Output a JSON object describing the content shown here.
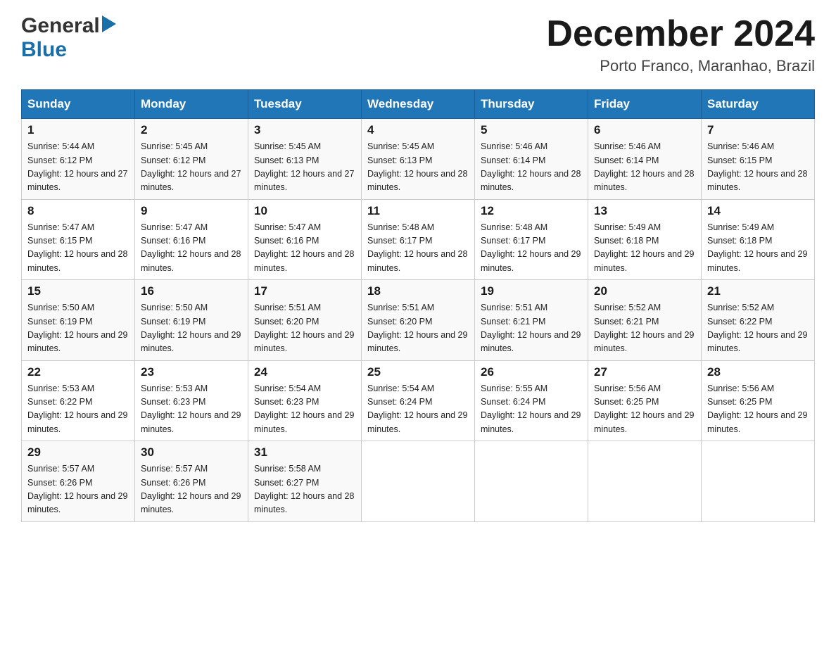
{
  "header": {
    "logo": {
      "general": "General",
      "blue": "Blue",
      "arrow_color": "#1a6fa8"
    },
    "title": "December 2024",
    "location": "Porto Franco, Maranhao, Brazil"
  },
  "calendar": {
    "days_of_week": [
      "Sunday",
      "Monday",
      "Tuesday",
      "Wednesday",
      "Thursday",
      "Friday",
      "Saturday"
    ],
    "weeks": [
      [
        {
          "day": "1",
          "sunrise": "Sunrise: 5:44 AM",
          "sunset": "Sunset: 6:12 PM",
          "daylight": "Daylight: 12 hours and 27 minutes."
        },
        {
          "day": "2",
          "sunrise": "Sunrise: 5:45 AM",
          "sunset": "Sunset: 6:12 PM",
          "daylight": "Daylight: 12 hours and 27 minutes."
        },
        {
          "day": "3",
          "sunrise": "Sunrise: 5:45 AM",
          "sunset": "Sunset: 6:13 PM",
          "daylight": "Daylight: 12 hours and 27 minutes."
        },
        {
          "day": "4",
          "sunrise": "Sunrise: 5:45 AM",
          "sunset": "Sunset: 6:13 PM",
          "daylight": "Daylight: 12 hours and 28 minutes."
        },
        {
          "day": "5",
          "sunrise": "Sunrise: 5:46 AM",
          "sunset": "Sunset: 6:14 PM",
          "daylight": "Daylight: 12 hours and 28 minutes."
        },
        {
          "day": "6",
          "sunrise": "Sunrise: 5:46 AM",
          "sunset": "Sunset: 6:14 PM",
          "daylight": "Daylight: 12 hours and 28 minutes."
        },
        {
          "day": "7",
          "sunrise": "Sunrise: 5:46 AM",
          "sunset": "Sunset: 6:15 PM",
          "daylight": "Daylight: 12 hours and 28 minutes."
        }
      ],
      [
        {
          "day": "8",
          "sunrise": "Sunrise: 5:47 AM",
          "sunset": "Sunset: 6:15 PM",
          "daylight": "Daylight: 12 hours and 28 minutes."
        },
        {
          "day": "9",
          "sunrise": "Sunrise: 5:47 AM",
          "sunset": "Sunset: 6:16 PM",
          "daylight": "Daylight: 12 hours and 28 minutes."
        },
        {
          "day": "10",
          "sunrise": "Sunrise: 5:47 AM",
          "sunset": "Sunset: 6:16 PM",
          "daylight": "Daylight: 12 hours and 28 minutes."
        },
        {
          "day": "11",
          "sunrise": "Sunrise: 5:48 AM",
          "sunset": "Sunset: 6:17 PM",
          "daylight": "Daylight: 12 hours and 28 minutes."
        },
        {
          "day": "12",
          "sunrise": "Sunrise: 5:48 AM",
          "sunset": "Sunset: 6:17 PM",
          "daylight": "Daylight: 12 hours and 29 minutes."
        },
        {
          "day": "13",
          "sunrise": "Sunrise: 5:49 AM",
          "sunset": "Sunset: 6:18 PM",
          "daylight": "Daylight: 12 hours and 29 minutes."
        },
        {
          "day": "14",
          "sunrise": "Sunrise: 5:49 AM",
          "sunset": "Sunset: 6:18 PM",
          "daylight": "Daylight: 12 hours and 29 minutes."
        }
      ],
      [
        {
          "day": "15",
          "sunrise": "Sunrise: 5:50 AM",
          "sunset": "Sunset: 6:19 PM",
          "daylight": "Daylight: 12 hours and 29 minutes."
        },
        {
          "day": "16",
          "sunrise": "Sunrise: 5:50 AM",
          "sunset": "Sunset: 6:19 PM",
          "daylight": "Daylight: 12 hours and 29 minutes."
        },
        {
          "day": "17",
          "sunrise": "Sunrise: 5:51 AM",
          "sunset": "Sunset: 6:20 PM",
          "daylight": "Daylight: 12 hours and 29 minutes."
        },
        {
          "day": "18",
          "sunrise": "Sunrise: 5:51 AM",
          "sunset": "Sunset: 6:20 PM",
          "daylight": "Daylight: 12 hours and 29 minutes."
        },
        {
          "day": "19",
          "sunrise": "Sunrise: 5:51 AM",
          "sunset": "Sunset: 6:21 PM",
          "daylight": "Daylight: 12 hours and 29 minutes."
        },
        {
          "day": "20",
          "sunrise": "Sunrise: 5:52 AM",
          "sunset": "Sunset: 6:21 PM",
          "daylight": "Daylight: 12 hours and 29 minutes."
        },
        {
          "day": "21",
          "sunrise": "Sunrise: 5:52 AM",
          "sunset": "Sunset: 6:22 PM",
          "daylight": "Daylight: 12 hours and 29 minutes."
        }
      ],
      [
        {
          "day": "22",
          "sunrise": "Sunrise: 5:53 AM",
          "sunset": "Sunset: 6:22 PM",
          "daylight": "Daylight: 12 hours and 29 minutes."
        },
        {
          "day": "23",
          "sunrise": "Sunrise: 5:53 AM",
          "sunset": "Sunset: 6:23 PM",
          "daylight": "Daylight: 12 hours and 29 minutes."
        },
        {
          "day": "24",
          "sunrise": "Sunrise: 5:54 AM",
          "sunset": "Sunset: 6:23 PM",
          "daylight": "Daylight: 12 hours and 29 minutes."
        },
        {
          "day": "25",
          "sunrise": "Sunrise: 5:54 AM",
          "sunset": "Sunset: 6:24 PM",
          "daylight": "Daylight: 12 hours and 29 minutes."
        },
        {
          "day": "26",
          "sunrise": "Sunrise: 5:55 AM",
          "sunset": "Sunset: 6:24 PM",
          "daylight": "Daylight: 12 hours and 29 minutes."
        },
        {
          "day": "27",
          "sunrise": "Sunrise: 5:56 AM",
          "sunset": "Sunset: 6:25 PM",
          "daylight": "Daylight: 12 hours and 29 minutes."
        },
        {
          "day": "28",
          "sunrise": "Sunrise: 5:56 AM",
          "sunset": "Sunset: 6:25 PM",
          "daylight": "Daylight: 12 hours and 29 minutes."
        }
      ],
      [
        {
          "day": "29",
          "sunrise": "Sunrise: 5:57 AM",
          "sunset": "Sunset: 6:26 PM",
          "daylight": "Daylight: 12 hours and 29 minutes."
        },
        {
          "day": "30",
          "sunrise": "Sunrise: 5:57 AM",
          "sunset": "Sunset: 6:26 PM",
          "daylight": "Daylight: 12 hours and 29 minutes."
        },
        {
          "day": "31",
          "sunrise": "Sunrise: 5:58 AM",
          "sunset": "Sunset: 6:27 PM",
          "daylight": "Daylight: 12 hours and 28 minutes."
        },
        {
          "day": "",
          "sunrise": "",
          "sunset": "",
          "daylight": ""
        },
        {
          "day": "",
          "sunrise": "",
          "sunset": "",
          "daylight": ""
        },
        {
          "day": "",
          "sunrise": "",
          "sunset": "",
          "daylight": ""
        },
        {
          "day": "",
          "sunrise": "",
          "sunset": "",
          "daylight": ""
        }
      ]
    ]
  }
}
